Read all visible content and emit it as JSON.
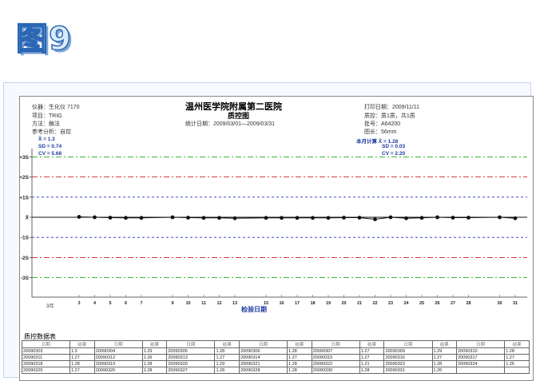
{
  "slide": {
    "title": "图9"
  },
  "report": {
    "hospital": "温州医学院附属第二医院",
    "subtitle": "质控图",
    "left_lines": [
      "仪器：生化仪 7170",
      "项目：TRIG",
      "方法：酶法",
      "参考分析：自控"
    ],
    "period": "统计日期：2009/03/01—2009/03/31",
    "right_lines": [
      "打印日期：2009/11/11",
      "质控：质1质，共1质",
      "批号：A64200",
      "图长：56mm"
    ]
  },
  "stats_left": [
    "X̄ = 1.3",
    "SD = 0.74",
    "CV = 5.68"
  ],
  "stats_right": [
    "本月计算 X̄ = 1.28",
    "SD = 0.03",
    "CV = 2.20"
  ],
  "chart_data": {
    "type": "line",
    "xlabel": "检验日期",
    "month_label": "3月",
    "y_tick_labels": [
      "+3S",
      "+2S",
      "+1S",
      "X̄",
      "-1S",
      "-2S",
      "-3S"
    ],
    "ylim": [
      -3.6,
      3.6
    ],
    "x": [
      3,
      4,
      5,
      6,
      7,
      9,
      10,
      11,
      12,
      13,
      15,
      16,
      17,
      18,
      19,
      20,
      21,
      22,
      23,
      24,
      25,
      26,
      27,
      28,
      30,
      31
    ],
    "x_tick_labels": [
      "3",
      "4",
      "5",
      "6",
      "7",
      "9",
      "10",
      "11",
      "12",
      "13",
      "15",
      "16",
      "17",
      "18",
      "19",
      "20",
      "21",
      "22",
      "23",
      "24",
      "25",
      "26",
      "27",
      "28",
      "30",
      "31"
    ],
    "values": [
      0.02,
      0.0,
      -0.02,
      -0.03,
      -0.03,
      0.0,
      -0.02,
      -0.03,
      -0.03,
      -0.05,
      -0.03,
      -0.03,
      -0.03,
      -0.03,
      -0.03,
      -0.02,
      -0.02,
      -0.1,
      0.0,
      -0.05,
      -0.03,
      0.0,
      -0.02,
      -0.02,
      0.0,
      -0.05
    ],
    "grid": true,
    "colors": {
      "sd3": "#22aa22",
      "sd2": "#cc2222",
      "sd1": "#2233aa",
      "mean": "#111111",
      "series": "#111111"
    }
  },
  "qc_table": {
    "title": "质控数据表",
    "headers": [
      "日期",
      "结果",
      "日期",
      "结果",
      "日期",
      "结果",
      "日期",
      "结果",
      "日期",
      "结果",
      "日期",
      "结果",
      "日期",
      "结果"
    ],
    "rows": [
      [
        "20090303",
        "1.3",
        "20090304",
        "1.29",
        "20090305",
        "1.28",
        "20090306",
        "1.28",
        "20090307",
        "1.27",
        "20090309",
        "1.29",
        "20090310",
        "1.28"
      ],
      [
        "20090311",
        "1.27",
        "20090312",
        "1.26",
        "20090313",
        "1.27",
        "20090314",
        "1.27",
        "20090315",
        "1.27",
        "20090316",
        "1.27",
        "20090317",
        "1.27"
      ],
      [
        "20090318",
        "1.28",
        "20090319",
        "1.28",
        "20090320",
        "1.29",
        "20090321",
        "1.28",
        "20090322",
        "1.21",
        "20090323",
        "1.28",
        "20090324",
        "1.26"
      ],
      [
        "20090325",
        "1.27",
        "20090326",
        "1.28",
        "20090327",
        "1.28",
        "20090328",
        "1.28",
        "20090330",
        "1.28",
        "20090331",
        "1.26",
        "",
        ""
      ]
    ]
  }
}
